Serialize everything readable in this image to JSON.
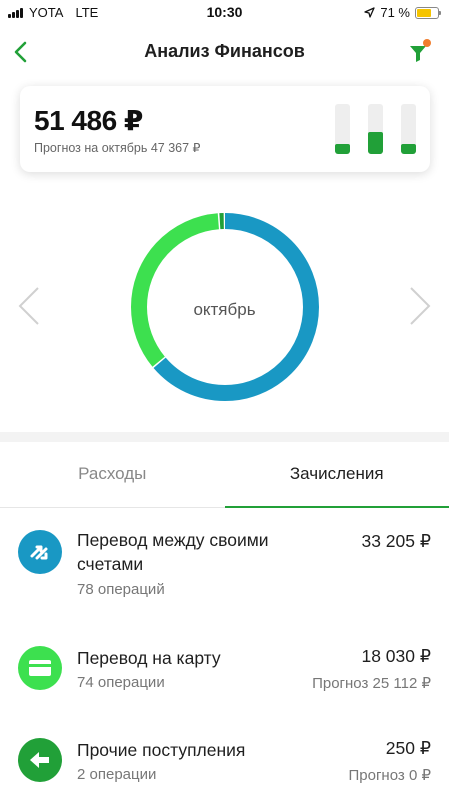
{
  "status_bar": {
    "carrier": "YOTA",
    "network": "LTE",
    "time": "10:30",
    "battery_percent": "71 %",
    "battery_level": 0.71
  },
  "nav": {
    "title": "Анализ Финансов",
    "back_icon": "chevron-left-icon",
    "filter_icon": "filter-icon"
  },
  "summary": {
    "amount": "51 486 ₽",
    "forecast": "Прогноз на октябрь 47 367 ₽",
    "mini_bars": [
      0.2,
      0.45,
      0.2
    ]
  },
  "donut": {
    "label": "октябрь",
    "segments": [
      {
        "share": 0.64,
        "color": "#1998c4"
      },
      {
        "share": 0.35,
        "color": "#3de04f"
      },
      {
        "share": 0.01,
        "color": "#21a038"
      }
    ]
  },
  "tabs": [
    {
      "label": "Расходы",
      "active": false
    },
    {
      "label": "Зачисления",
      "active": true
    }
  ],
  "items": [
    {
      "title": "Перевод между своими счетами",
      "subtitle": "78 операций",
      "amount": "33 205 ₽",
      "forecast": "",
      "icon": "transfer-arrows-icon",
      "icon_color": "#1998c4"
    },
    {
      "title": "Перевод на карту",
      "subtitle": "74 операции",
      "amount": "18 030 ₽",
      "forecast": "Прогноз 25 112 ₽",
      "icon": "card-icon",
      "icon_color": "#3de04f"
    },
    {
      "title": "Прочие поступления",
      "subtitle": "2 операции",
      "amount": "250 ₽",
      "forecast": "Прогноз 0 ₽",
      "icon": "arrow-left-icon",
      "icon_color": "#21a038"
    }
  ],
  "colors": {
    "accent": "#21a038",
    "blue": "#1998c4",
    "light_green": "#3de04f"
  }
}
